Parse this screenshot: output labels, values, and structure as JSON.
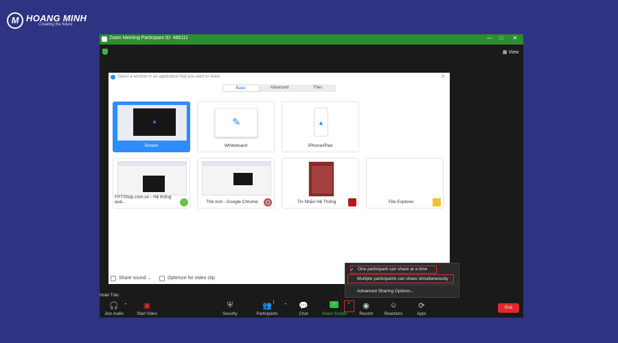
{
  "brand": {
    "name": "HOANG MINH",
    "tagline": "Creating the future",
    "mark": "M"
  },
  "window": {
    "title": "Zoom Meeting Participant ID: 466111",
    "controls": [
      "—",
      "□",
      "✕"
    ],
    "view_label": "View"
  },
  "dialog": {
    "title": "Select a window or an application that you want to share",
    "close": "✕",
    "tabs": [
      "Basic",
      "Advanced",
      "Files"
    ],
    "tiles": [
      {
        "label": "Screen"
      },
      {
        "label": "Whiteboard"
      },
      {
        "label": "iPhone/iPad"
      },
      {
        "label": "FPTShop.com.vn - Hệ thống quả..."
      },
      {
        "label": "Thẻ mới - Google Chrome"
      },
      {
        "label": "Tin Nhắn Hệ Thống"
      },
      {
        "label": "File Explorer"
      }
    ],
    "options": {
      "share_sound": "Share sound",
      "optimize_video": "Optimize for video clip"
    }
  },
  "share_menu": {
    "items": [
      "One participant can share at a time",
      "Multiple participants can share simultaneously",
      "Advanced Sharing Options..."
    ],
    "checkmark": "✓"
  },
  "participant_name": "Hoàn Trần",
  "toolbar": {
    "join_audio": "Join Audio",
    "start_video": "Start Video",
    "security": "Security",
    "participants": "Participants",
    "participant_count": "1",
    "chat": "Chat",
    "share_screen": "Share Screen",
    "record": "Record",
    "reactions": "Reactions",
    "apps": "Apps",
    "end": "End"
  },
  "colors": {
    "background": "#2e3482",
    "titlebar": "#2d8d2f",
    "accent": "#2d8cff",
    "highlight": "#e0282e",
    "share_green": "#2fbf44"
  }
}
